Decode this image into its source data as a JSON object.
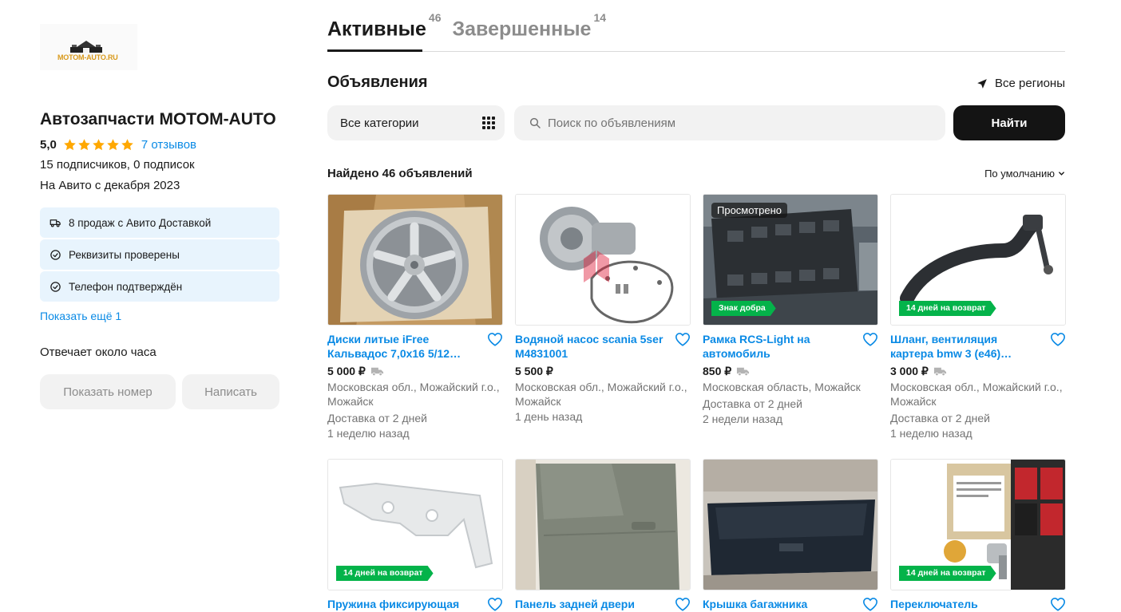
{
  "seller": {
    "logo_text": "MOTOM-AUTO.RU",
    "name": "Автозапчасти MOTOM-AUTO",
    "rating": "5,0",
    "reviews": "7 отзывов",
    "subscribers": "15 подписчиков, 0 подписок",
    "since": "На Авито с декабря 2023",
    "badges": [
      {
        "icon": "truck-icon",
        "label": "8 продаж с Авито Доставкой"
      },
      {
        "icon": "check-circle-icon",
        "label": "Реквизиты проверены"
      },
      {
        "icon": "check-circle-icon",
        "label": "Телефон подтверждён"
      }
    ],
    "show_more": "Показать ещё 1",
    "response_time": "Отвечает около часа",
    "show_phone": "Показать номер",
    "write": "Написать"
  },
  "tabs": [
    {
      "label": "Активные",
      "count": "46",
      "active": true
    },
    {
      "label": "Завершенные",
      "count": "14",
      "active": false
    }
  ],
  "section_title": "Объявления",
  "region": "Все регионы",
  "category_select": "Все категории",
  "search": {
    "placeholder": "Поиск по объявлениям",
    "button": "Найти"
  },
  "found": "Найдено 46 объявлений",
  "sort": "По умолчанию",
  "colors": {
    "accent_link": "#0a8ae5",
    "badge_bg": "#e8f4fd",
    "green_tag": "#04b34a",
    "button_dark": "#141414",
    "star": "#ffa800"
  },
  "listings": [
    {
      "title": "Диски литые iFree Кальвадос 7,0x16 5/12…",
      "price": "5 000 ₽",
      "delivery_icon": true,
      "location": "Московская обл., Можайский г.о., Можайск",
      "delivery": "Доставка от 2 дней",
      "time": "1 неделю назад"
    },
    {
      "title": "Водяной насос scania 5ser M4831001",
      "price": "5 500 ₽",
      "delivery_icon": false,
      "location": "Московская обл., Можайский г.о., Можайск",
      "delivery": "",
      "time": "1 день назад"
    },
    {
      "title": "Рамка RCS-Light на автомобиль",
      "price": "850 ₽",
      "delivery_icon": true,
      "location": "Московская область, Можайск",
      "delivery": "Доставка от 2 дней",
      "time": "2 недели назад",
      "viewed": "Просмотрено",
      "tag": "Знак добра"
    },
    {
      "title": "Шланг, вентиляция картера bmw 3 (e46)…",
      "price": "3 000 ₽",
      "delivery_icon": true,
      "location": "Московская обл., Можайский г.о., Можайск",
      "delivery": "Доставка от 2 дней",
      "time": "1 неделю назад",
      "tag": "14 дней на возврат"
    },
    {
      "title": "Пружина фиксирующая",
      "tag": "14 дней на возврат"
    },
    {
      "title": "Панель задней двери"
    },
    {
      "title": "Крышка багажника"
    },
    {
      "title": "Переключатель",
      "tag": "14 дней на возврат"
    }
  ]
}
